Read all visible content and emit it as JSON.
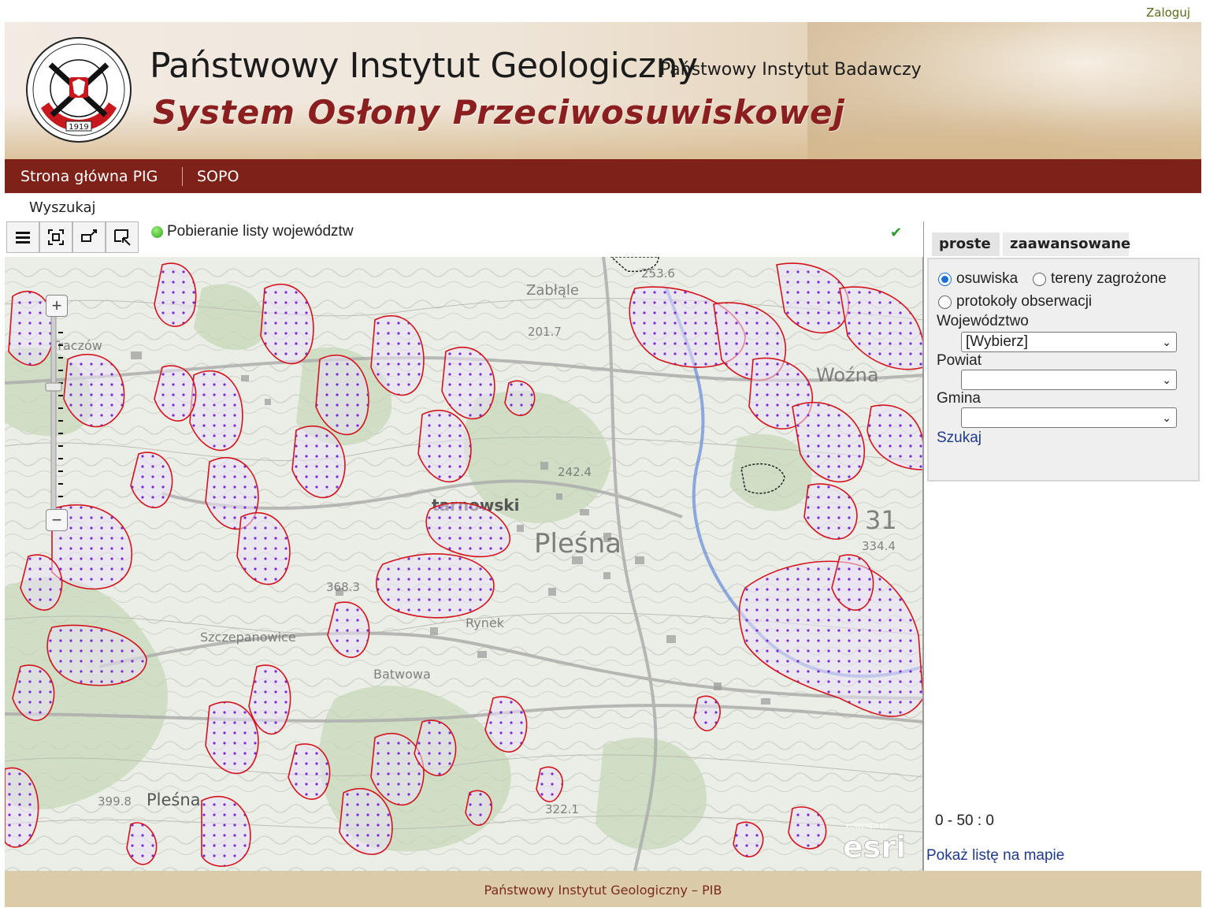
{
  "login": "Zaloguj",
  "header": {
    "title": "Państwowy Instytut Geologiczny",
    "subtitle": "Państwowy Instytut Badawczy",
    "system": "System Osłony Przeciwosuwiskowej",
    "logo_text": "1919"
  },
  "nav": {
    "items": [
      {
        "label": "Strona główna PIG"
      },
      {
        "label": "SOPO"
      }
    ]
  },
  "subnav": {
    "label": "Wyszukaj"
  },
  "toolbar": {
    "status": "Pobieranie listy województw"
  },
  "map": {
    "labels": [
      "Zabłąle",
      "tarnowski",
      "Pleśna",
      "Pleśna",
      "Woźna",
      "Szczepanowice",
      "Rynek",
      "Batwowa",
      "Traczów",
      "tarnowski",
      "31"
    ],
    "elevations": [
      "253.6",
      "201.7",
      "242.4",
      "334.4",
      "368.3",
      "399.8",
      "322.1"
    ],
    "attribution": "esri",
    "attribution_small": "POWERED BY"
  },
  "panel": {
    "tabs": [
      {
        "label": "proste"
      },
      {
        "label": "zaawansowane"
      }
    ],
    "radios": [
      {
        "label": "osuwiska",
        "checked": true
      },
      {
        "label": "tereny zagrożone",
        "checked": false
      },
      {
        "label": "protokoły obserwacji",
        "checked": false
      }
    ],
    "wojewodztwo_label": "Województwo",
    "wojewodztwo_value": "[Wybierz]",
    "powiat_label": "Powiat",
    "powiat_value": "",
    "gmina_label": "Gmina",
    "gmina_value": "",
    "search_link": "Szukaj",
    "count": "0 - 50 : 0",
    "show_list": "Pokaż listę na mapie"
  },
  "footer": {
    "text": "Państwowy Instytut Geologiczny – PIB"
  },
  "colors": {
    "nav_bg": "#7e2118",
    "footer_bg": "#dccba8",
    "landslide_outline": "#d4141c",
    "landslide_dots": "#7a2bd6"
  }
}
